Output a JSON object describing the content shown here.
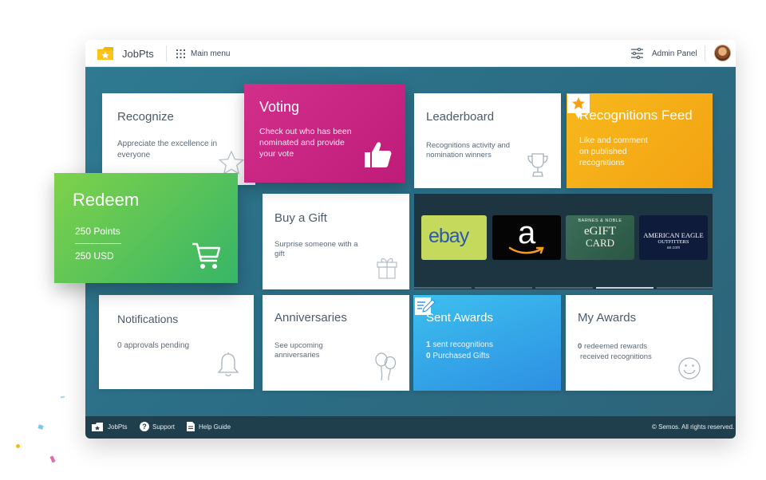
{
  "app": {
    "title": "JobPts",
    "main_menu_label": "Main menu",
    "admin_panel_label": "Admin Panel"
  },
  "cards": {
    "recognize": {
      "title": "Recognize",
      "desc": "Appreciate the excellence in everyone"
    },
    "voting": {
      "title": "Voting",
      "desc": "Check out who has been nominated and provide your vote"
    },
    "leaderboard": {
      "title": "Leaderboard",
      "desc": "Recognitions activity and nomination winners"
    },
    "feed": {
      "title": "Recognitions Feed",
      "desc": "Like and comment on published recognitions"
    },
    "redeem": {
      "title": "Redeem",
      "points": "250 Points",
      "usd": "250 USD"
    },
    "gift": {
      "title": "Buy a Gift",
      "desc": "Surprise someone with a gift"
    },
    "notifications": {
      "title": "Notifications",
      "desc": "0 approvals pending"
    },
    "anniversaries": {
      "title": "Anniversaries",
      "desc": "See upcoming anniversaries"
    },
    "sent": {
      "title": "Sent Awards",
      "count1": "1",
      "text1": "sent recognitions",
      "count2": "0",
      "text2": "Purchased Gifts"
    },
    "my_awards": {
      "title": "My Awards",
      "count1": "0",
      "text1": "redeemed rewards",
      "text2": "received recognitions"
    }
  },
  "gift_cards": {
    "ebay": "ebay",
    "amazon": "a",
    "bn_top": "BARNES & NOBLE",
    "bn_main1": "eGIFT",
    "bn_main2": "CARD",
    "ae1": "AMERICAN EAGLE",
    "ae2": "OUTFITTERS",
    "ae3": "ae.com"
  },
  "footer": {
    "brand": "JobPts",
    "support": "Support",
    "help": "Help Guide",
    "copyright": "© Semos. All rights reserved."
  },
  "colors": {
    "voting": "#c9247f",
    "feed": "#f5ac16",
    "redeem": "#4cc15a",
    "sent": "#3aa7ea",
    "workspace": "#2c6f85",
    "footer": "#1f3f4d"
  },
  "icons": {
    "recognize": "star-outline-icon",
    "voting": "thumbs-up-icon",
    "leaderboard": "trophy-icon",
    "feed": "star-badge-icon",
    "redeem": "cart-icon",
    "gift": "gift-icon",
    "notifications": "bell-icon",
    "anniversaries": "balloons-icon",
    "sent": "edit-document-icon",
    "my_awards": "smiley-icon"
  }
}
